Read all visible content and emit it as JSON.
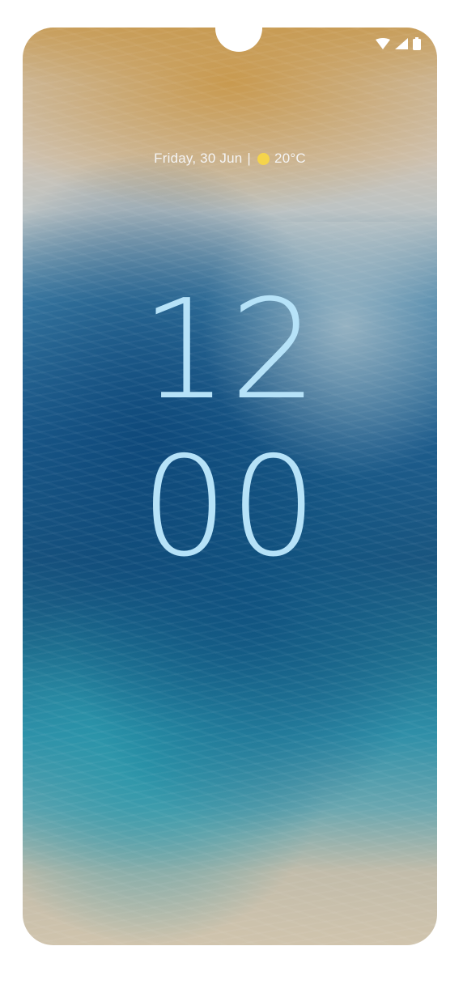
{
  "lockscreen": {
    "date": "Friday, 30 Jun",
    "separator": "|",
    "temperature": "20°C",
    "weather_icon": "sun-icon",
    "clock": {
      "hour": "12",
      "minute": "00"
    }
  },
  "status_bar": {
    "icons": [
      "wifi-icon",
      "signal-icon",
      "battery-icon"
    ]
  },
  "colors": {
    "clock": "#b6e2f8",
    "sun": "#f5d44b",
    "text": "#f4f4f4"
  }
}
